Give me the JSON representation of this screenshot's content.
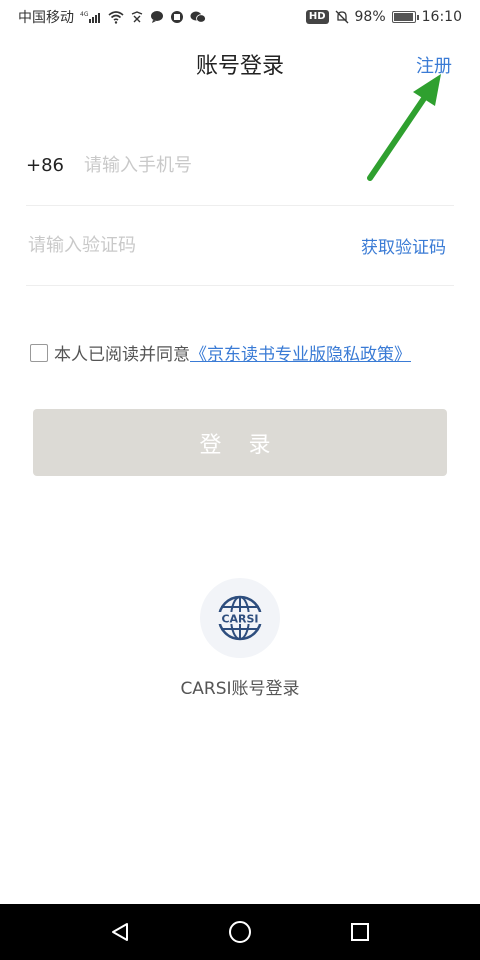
{
  "status_bar": {
    "carrier": "中国移动",
    "network": "4G",
    "battery": "98%",
    "battery_level": 0.98,
    "time": "16:10",
    "icons": [
      "signal-icon",
      "wifi-icon",
      "notification-icon",
      "chat-icon",
      "app-icon",
      "wechat-icon",
      "hd-icon",
      "mute-icon",
      "battery-icon"
    ]
  },
  "header": {
    "title": "账号登录",
    "register": "注册"
  },
  "login_form": {
    "country_code": "+86",
    "phone_placeholder": "请输入手机号",
    "code_placeholder": "请输入验证码",
    "get_code": "获取验证码"
  },
  "agreement": {
    "prefix": "本人已阅读并同意",
    "policy_link": "《京东读书专业版隐私政策》"
  },
  "login_button": "登 录",
  "carsi": {
    "logo_text": "CARSI",
    "label": "CARSI账号登录"
  },
  "colors": {
    "accent": "#3a7bd5",
    "button_disabled": "#dcdad5",
    "arrow": "#2fa02f"
  }
}
